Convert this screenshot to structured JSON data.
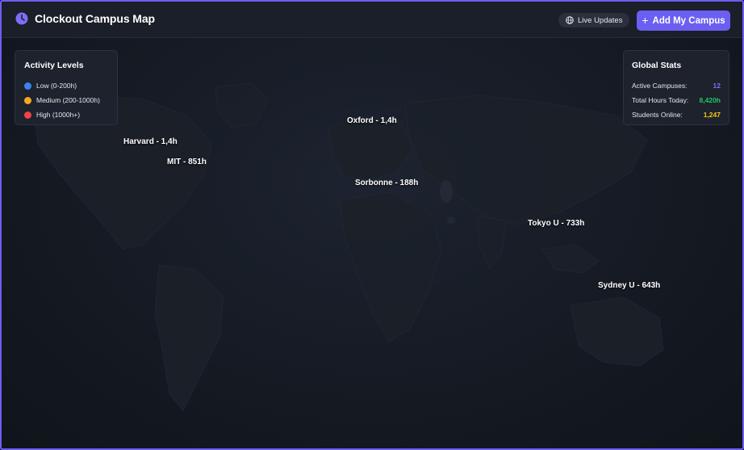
{
  "header": {
    "title": "Clockout Campus Map",
    "logo_icon": "clock-icon",
    "live_label": "Live Updates",
    "add_button_label": "Add My Campus"
  },
  "legend": {
    "title": "Activity Levels",
    "items": [
      {
        "label": "Low (0-200h)",
        "color": "#3b82f6"
      },
      {
        "label": "Medium (200-1000h)",
        "color": "#f5a623"
      },
      {
        "label": "High (1000h+)",
        "color": "#ef4444"
      }
    ]
  },
  "stats": {
    "title": "Global Stats",
    "rows": [
      {
        "label": "Active Campuses:",
        "value": "12",
        "color": "#7b6ff5"
      },
      {
        "label": "Total Hours Today:",
        "value": "8,420h",
        "color": "#22c55e"
      },
      {
        "label": "Students Online:",
        "value": "1,247",
        "color": "#f5c518"
      }
    ]
  },
  "campuses": [
    {
      "name": "oxford",
      "label": "Oxford - 1,4h"
    },
    {
      "name": "harvard",
      "label": "Harvard - 1,4h"
    },
    {
      "name": "mit",
      "label": "MIT - 851h"
    },
    {
      "name": "sorbonne",
      "label": "Sorbonne - 188h"
    },
    {
      "name": "tokyo-u",
      "label": "Tokyo U - 733h"
    },
    {
      "name": "sydney-u",
      "label": "Sydney U - 643h"
    }
  ],
  "colors": {
    "accent": "#6a5ff0",
    "background": "#151a23"
  }
}
